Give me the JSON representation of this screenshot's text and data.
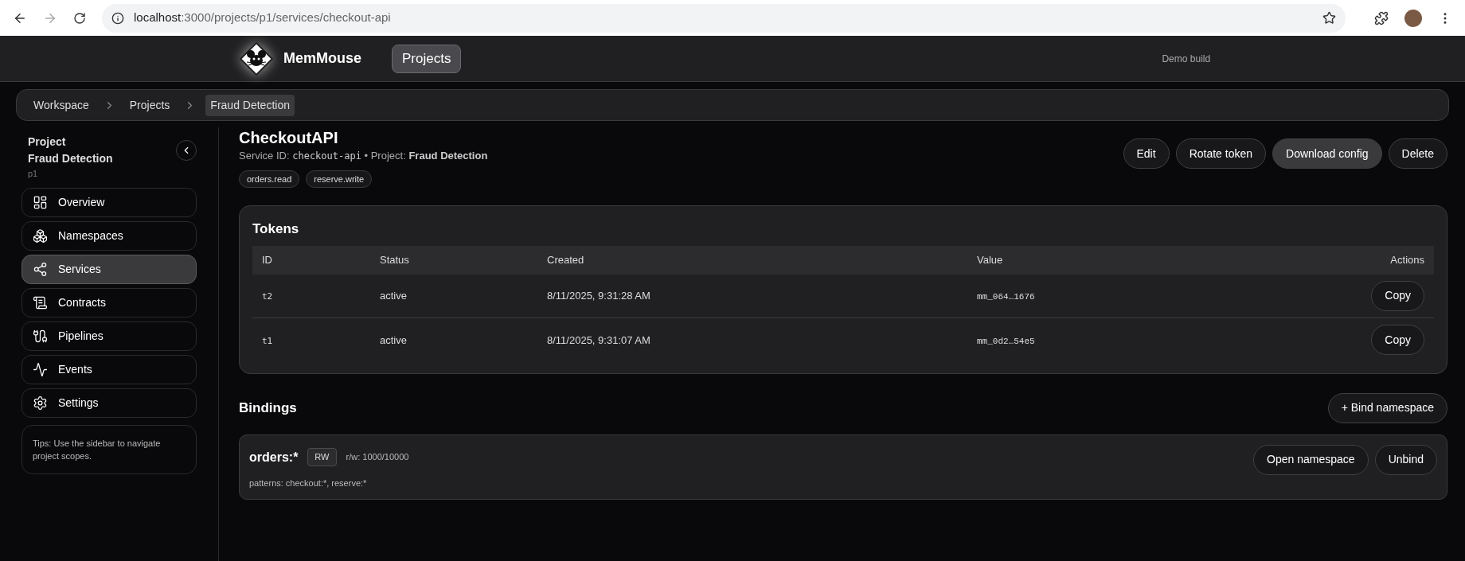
{
  "browser": {
    "url_host": "localhost",
    "url_path": ":3000/projects/p1/services/checkout-api"
  },
  "app_header": {
    "brand": "MemMouse",
    "nav": [
      {
        "label": "Projects",
        "selected": true
      }
    ],
    "build_label": "Demo build"
  },
  "breadcrumb": [
    {
      "label": "Workspace",
      "selected": false
    },
    {
      "label": "Projects",
      "selected": false
    },
    {
      "label": "Fraud Detection",
      "selected": true
    }
  ],
  "sidebar": {
    "heading": "Project",
    "project_name": "Fraud Detection",
    "project_id": "p1",
    "items": [
      {
        "label": "Overview",
        "kind": "overview",
        "selected": false
      },
      {
        "label": "Namespaces",
        "kind": "namespaces",
        "selected": false
      },
      {
        "label": "Services",
        "kind": "services",
        "selected": true
      },
      {
        "label": "Contracts",
        "kind": "contracts",
        "selected": false
      },
      {
        "label": "Pipelines",
        "kind": "pipelines",
        "selected": false
      },
      {
        "label": "Events",
        "kind": "events",
        "selected": false
      },
      {
        "label": "Settings",
        "kind": "settings",
        "selected": false
      }
    ],
    "tip": "Tips: Use the sidebar to navigate project scopes."
  },
  "service": {
    "title": "CheckoutAPI",
    "id_label": "Service ID:",
    "id": "checkout-api",
    "project_label": "• Project:",
    "project": "Fraud Detection",
    "scopes": [
      "orders.read",
      "reserve.write"
    ],
    "actions": [
      {
        "label": "Edit",
        "selected": false
      },
      {
        "label": "Rotate token",
        "selected": false
      },
      {
        "label": "Download config",
        "selected": true
      },
      {
        "label": "Delete",
        "selected": false
      }
    ]
  },
  "tokens": {
    "title": "Tokens",
    "columns": [
      "ID",
      "Status",
      "Created",
      "Value",
      "Actions"
    ],
    "rows": [
      {
        "id": "t2",
        "status": "active",
        "created": "8/11/2025, 9:31:28 AM",
        "value": "mm_064…1676",
        "action": "Copy"
      },
      {
        "id": "t1",
        "status": "active",
        "created": "8/11/2025, 9:31:07 AM",
        "value": "mm_0d2…54e5",
        "action": "Copy"
      }
    ]
  },
  "bindings": {
    "title": "Bindings",
    "add_button": "+ Bind namespace",
    "items": [
      {
        "namespace": "orders:*",
        "mode": "RW",
        "limits": "r/w: 1000/10000",
        "patterns": "patterns: checkout:*, reserve:*",
        "actions": [
          "Open namespace",
          "Unbind"
        ]
      }
    ]
  }
}
